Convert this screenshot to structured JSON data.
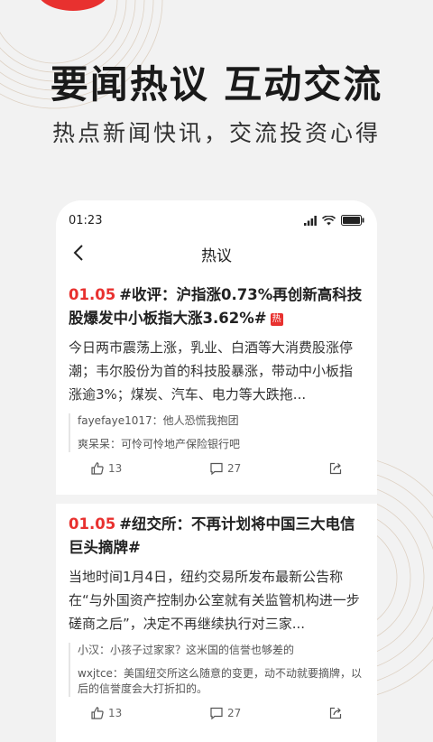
{
  "headline": "要闻热议 互动交流",
  "subhead": "热点新闻快讯，交流投资心得",
  "phone": {
    "status_time": "01:23",
    "nav_title": "热议"
  },
  "cards": [
    {
      "date": "01.05",
      "title": "#收评：沪指涨0.73%再创新高科技股爆发中小板指大涨3.62%#",
      "hot_tag": "热",
      "body": "今日两市震荡上涨，乳业、白酒等大消费股涨停潮；韦尔股份为首的科技股暴涨，带动中小板指涨逾3%；煤炭、汽车、电力等大跌拖...",
      "comments": [
        {
          "user": "fayefaye1017：",
          "text": "他人恐慌我抱团"
        },
        {
          "user": "爽呆呆：",
          "text": "可怜可怜地产保险银行吧"
        }
      ],
      "likes": "13",
      "comment_count": "27"
    },
    {
      "date": "01.05",
      "title": "#纽交所：不再计划将中国三大电信巨头摘牌#",
      "body": "当地时间1月4日，纽约交易所发布最新公告称在“与外国资产控制办公室就有关监管机构进一步磋商之后”，决定不再继续执行对三家...",
      "comments": [
        {
          "user": "小汉：",
          "text": "小孩子过家家？这米国的信誉也够差的"
        },
        {
          "user": "wxjtce：",
          "text": "美国纽交所这么随意的变更，动不动就要摘牌，以后的信誉度会大打折扣的。"
        }
      ],
      "likes": "13",
      "comment_count": "27"
    }
  ],
  "colors": {
    "accent": "#e8312f",
    "background": "#f2f2f2"
  },
  "icons": [
    "back-chevron-icon",
    "signal-icon",
    "wifi-icon",
    "battery-icon",
    "thumbs-up-icon",
    "comment-icon",
    "share-icon"
  ]
}
